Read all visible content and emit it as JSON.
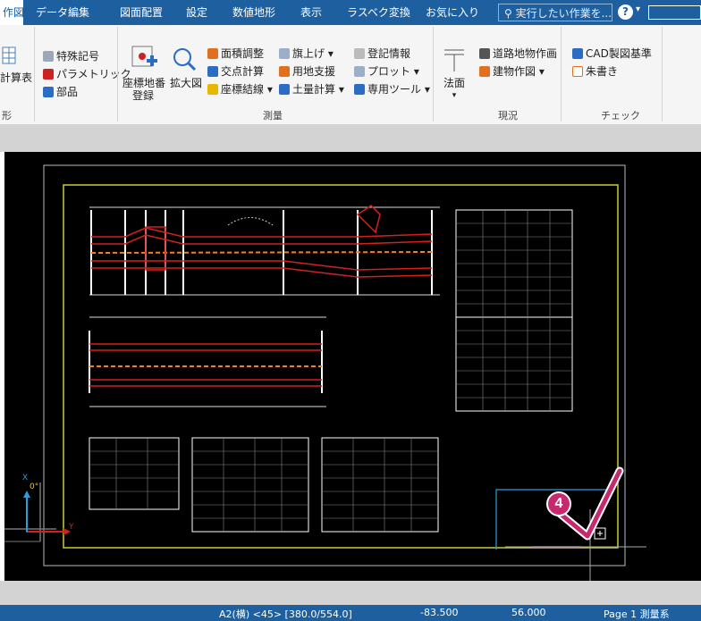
{
  "menubar": {
    "active_tab": "作図",
    "tabs": [
      "データ編集",
      "図面配置",
      "設定",
      "数値地形",
      "表示",
      "ラスベク変換",
      "お気に入り"
    ],
    "search_placeholder": "実行したい作業を...",
    "help": "?"
  },
  "ribbon": {
    "left_group": {
      "item_calc": "計算表",
      "label": "形"
    },
    "col1": [
      "特殊記号",
      "パラメトリック",
      "部品"
    ],
    "survey": {
      "coord_register_line1": "座標地番",
      "coord_register_line2": "登録",
      "zoom": "拡大図",
      "items_a": [
        "面積調整",
        "交点計算",
        "座標結線"
      ],
      "items_b": [
        "旗上げ",
        "用地支援",
        "土量計算"
      ],
      "items_c": [
        "登記情報",
        "プロット",
        "専用ツール"
      ],
      "label": "測量"
    },
    "genkyo": {
      "houmen": "法面",
      "items": [
        "道路地物作画",
        "建物作図"
      ],
      "label": "現況"
    },
    "check": {
      "items": [
        "CAD製図基準",
        "朱書き"
      ],
      "label": "チェック"
    }
  },
  "canvas": {
    "step_badge": "4",
    "axis_x": "X",
    "axis_y": "Y",
    "axis_angle": "0°"
  },
  "statusbar": {
    "paper": "A2(横) <45> [380.0/554.0]",
    "x": "-83.500",
    "y": "56.000",
    "page": "Page  1  測量系"
  },
  "colors": {
    "menubar": "#1e5f9f",
    "canvas_bg": "#000000",
    "frame": "#cccc33",
    "drawing_red": "#d42020",
    "badge": "#c8286e"
  }
}
